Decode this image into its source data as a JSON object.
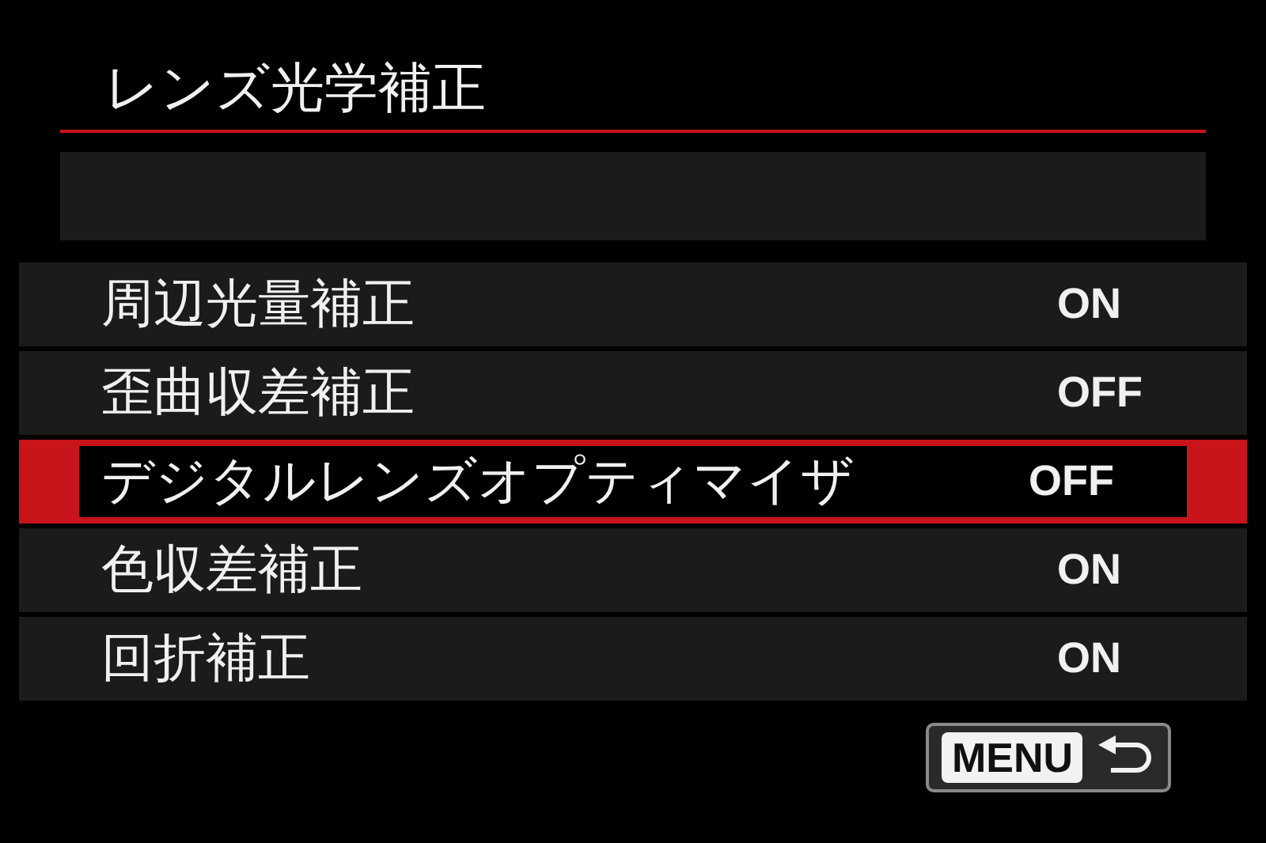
{
  "title": "レンズ光学補正",
  "items": [
    {
      "label": "周辺光量補正",
      "value": "ON",
      "selected": false
    },
    {
      "label": "歪曲収差補正",
      "value": "OFF",
      "selected": false
    },
    {
      "label": "デジタルレンズオプティマイザ",
      "value": "OFF",
      "selected": true
    },
    {
      "label": "色収差補正",
      "value": "ON",
      "selected": false
    },
    {
      "label": "回折補正",
      "value": "ON",
      "selected": false
    }
  ],
  "back_button": {
    "label": "MENU"
  }
}
